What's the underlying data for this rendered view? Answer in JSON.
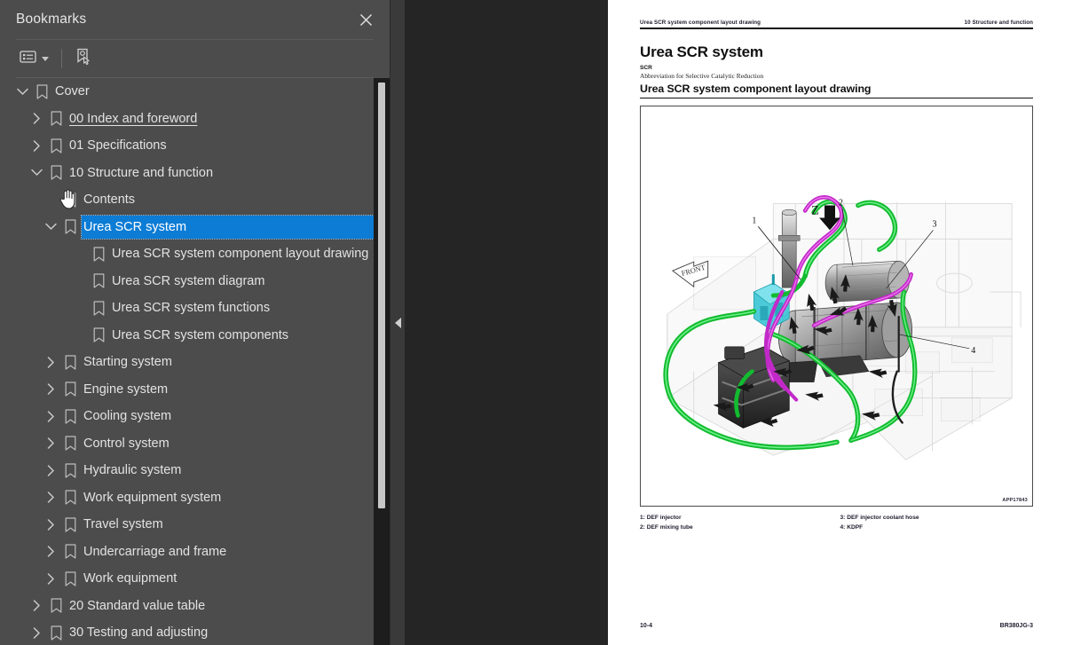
{
  "sidebar": {
    "title": "Bookmarks",
    "close_icon": "close-icon",
    "toolbar": {
      "options_label": "list-options-icon",
      "select_bookmark_label": "select-bookmark-icon"
    },
    "tree": [
      {
        "label": "Cover",
        "depth": 0,
        "twisty": "down",
        "state": "normal"
      },
      {
        "label": "00 Index and foreword",
        "depth": 1,
        "twisty": "right",
        "state": "hovered"
      },
      {
        "label": "01 Specifications",
        "depth": 1,
        "twisty": "right",
        "state": "normal"
      },
      {
        "label": "10 Structure and function",
        "depth": 1,
        "twisty": "down",
        "state": "normal"
      },
      {
        "label": "Contents",
        "depth": 2,
        "twisty": "none",
        "state": "normal"
      },
      {
        "label": "Urea SCR system",
        "depth": 2,
        "twisty": "down",
        "state": "selected"
      },
      {
        "label": "Urea SCR system component layout drawing",
        "depth": 3,
        "twisty": "none",
        "state": "normal"
      },
      {
        "label": "Urea SCR system diagram",
        "depth": 3,
        "twisty": "none",
        "state": "normal"
      },
      {
        "label": "Urea SCR system functions",
        "depth": 3,
        "twisty": "none",
        "state": "normal"
      },
      {
        "label": "Urea SCR system components",
        "depth": 3,
        "twisty": "none",
        "state": "normal"
      },
      {
        "label": "Starting system",
        "depth": 2,
        "twisty": "right",
        "state": "normal"
      },
      {
        "label": "Engine system",
        "depth": 2,
        "twisty": "right",
        "state": "normal"
      },
      {
        "label": "Cooling system",
        "depth": 2,
        "twisty": "right",
        "state": "normal"
      },
      {
        "label": "Control system",
        "depth": 2,
        "twisty": "right",
        "state": "normal"
      },
      {
        "label": "Hydraulic system",
        "depth": 2,
        "twisty": "right",
        "state": "normal"
      },
      {
        "label": "Work equipment system",
        "depth": 2,
        "twisty": "right",
        "state": "normal"
      },
      {
        "label": "Travel system",
        "depth": 2,
        "twisty": "right",
        "state": "normal"
      },
      {
        "label": "Undercarriage and frame",
        "depth": 2,
        "twisty": "right",
        "state": "normal"
      },
      {
        "label": "Work equipment",
        "depth": 2,
        "twisty": "right",
        "state": "normal"
      },
      {
        "label": "20 Standard value table",
        "depth": 1,
        "twisty": "right",
        "state": "normal"
      },
      {
        "label": "30 Testing and adjusting",
        "depth": 1,
        "twisty": "right",
        "state": "normal"
      }
    ],
    "selection_color": "#0c7cd5",
    "background_color": "#4c4c4c"
  },
  "reader": {
    "background_color": "#252526",
    "collapse_handle_icon": "collapse-left-icon"
  },
  "document": {
    "running_header_left": "Urea SCR system component layout drawing",
    "running_header_right": "10 Structure and function",
    "heading_1": "Urea SCR system",
    "abbreviation_term": "SCR",
    "abbreviation_definition": "Abbreviation for Selective Catalytic Reduction",
    "heading_2": "Urea SCR system component layout drawing",
    "figure": {
      "id": "APP17843",
      "orientation_label": "FRONT",
      "section_marker": "Z",
      "callouts": [
        "1",
        "2",
        "3",
        "4"
      ]
    },
    "key_left": [
      "1: DEF injector",
      "2: DEF mixing tube"
    ],
    "key_right": [
      "3: DEF injector coolant hose",
      "4: KDPF"
    ],
    "footer_left": "10-4",
    "footer_right": "BR380JG-3"
  }
}
